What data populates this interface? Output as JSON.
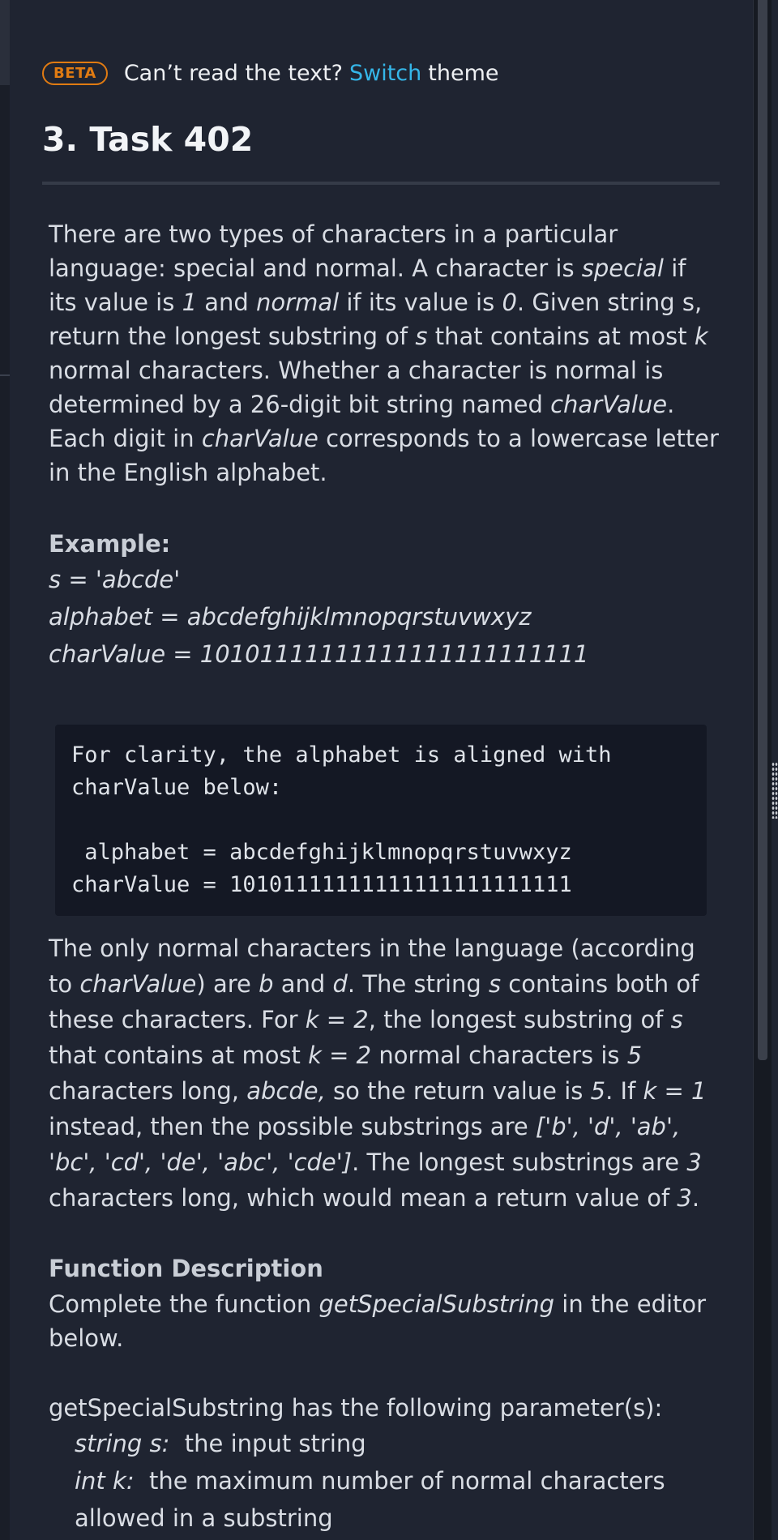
{
  "banner": {
    "badge": "BETA",
    "text_before": "Can’t read the text?",
    "switch_link": "Switch",
    "text_after": "theme"
  },
  "title": "3. Task 402",
  "description": {
    "p1": [
      {
        "t": "There are two types of characters in a particular language: special and normal. A character is "
      },
      {
        "t": "special",
        "i": true
      },
      {
        "t": " if its value is "
      },
      {
        "t": "1",
        "i": true
      },
      {
        "t": " and "
      },
      {
        "t": "normal",
        "i": true
      },
      {
        "t": " if its value is "
      },
      {
        "t": "0",
        "i": true
      },
      {
        "t": ". Given string s, return the longest substring of "
      },
      {
        "t": "s",
        "i": true
      },
      {
        "t": " that contains at most "
      },
      {
        "t": "k",
        "i": true
      },
      {
        "t": " normal characters. Whether a character is normal is determined by a 26-digit bit string named "
      },
      {
        "t": "charValue",
        "i": true
      },
      {
        "t": ". Each digit in "
      },
      {
        "t": "charValue",
        "i": true
      },
      {
        "t": " corresponds to a lowercase letter in the English alphabet."
      }
    ]
  },
  "example": {
    "heading": "Example:",
    "s_line": "s = 'abcde'",
    "alphabet_line": "alphabet = abcdefghijklmnopqrstuvwxyz",
    "charvalue_line": "charValue = 10101111111111111111111111"
  },
  "code_block": "For clarity, the alphabet is aligned with\ncharValue below:\n\n alphabet = abcdefghijklmnopqrstuvwxyz\ncharValue = 10101111111111111111111111",
  "explanation": [
    {
      "t": "The only normal characters in the language (according to "
    },
    {
      "t": "charValue",
      "i": true
    },
    {
      "t": ") are "
    },
    {
      "t": "b",
      "i": true
    },
    {
      "t": " and "
    },
    {
      "t": "d",
      "i": true
    },
    {
      "t": ". The string "
    },
    {
      "t": "s",
      "i": true
    },
    {
      "t": " contains both of these characters. For "
    },
    {
      "t": "k = 2",
      "i": true
    },
    {
      "t": ", the longest substring of "
    },
    {
      "t": "s",
      "i": true
    },
    {
      "t": " that contains at most "
    },
    {
      "t": "k = 2",
      "i": true
    },
    {
      "t": " normal characters is "
    },
    {
      "t": "5",
      "i": true
    },
    {
      "t": " characters long, "
    },
    {
      "t": "abcde,",
      "i": true
    },
    {
      "t": " so the return value is "
    },
    {
      "t": "5",
      "i": true
    },
    {
      "t": ". If "
    },
    {
      "t": "k = 1",
      "i": true
    },
    {
      "t": " instead, then the possible substrings are "
    },
    {
      "t": "['b', 'd', 'ab', 'bc', 'cd', 'de', 'abc', 'cde']",
      "i": true
    },
    {
      "t": ". The longest substrings are "
    },
    {
      "t": "3",
      "i": true
    },
    {
      "t": " characters long, which would mean a return value of "
    },
    {
      "t": "3",
      "i": true
    },
    {
      "t": "."
    }
  ],
  "function_description": {
    "heading": "Function Description",
    "text": [
      {
        "t": "Complete the function "
      },
      {
        "t": "getSpecialSubstring",
        "i": true
      },
      {
        "t": " in the editor below."
      }
    ]
  },
  "parameters": {
    "intro": "getSpecialSubstring has the following parameter(s):",
    "items": [
      {
        "name": "string s:",
        "desc": "the input string"
      },
      {
        "name": "int k:",
        "desc": "the maximum number of normal characters allowed in a substring"
      }
    ]
  }
}
